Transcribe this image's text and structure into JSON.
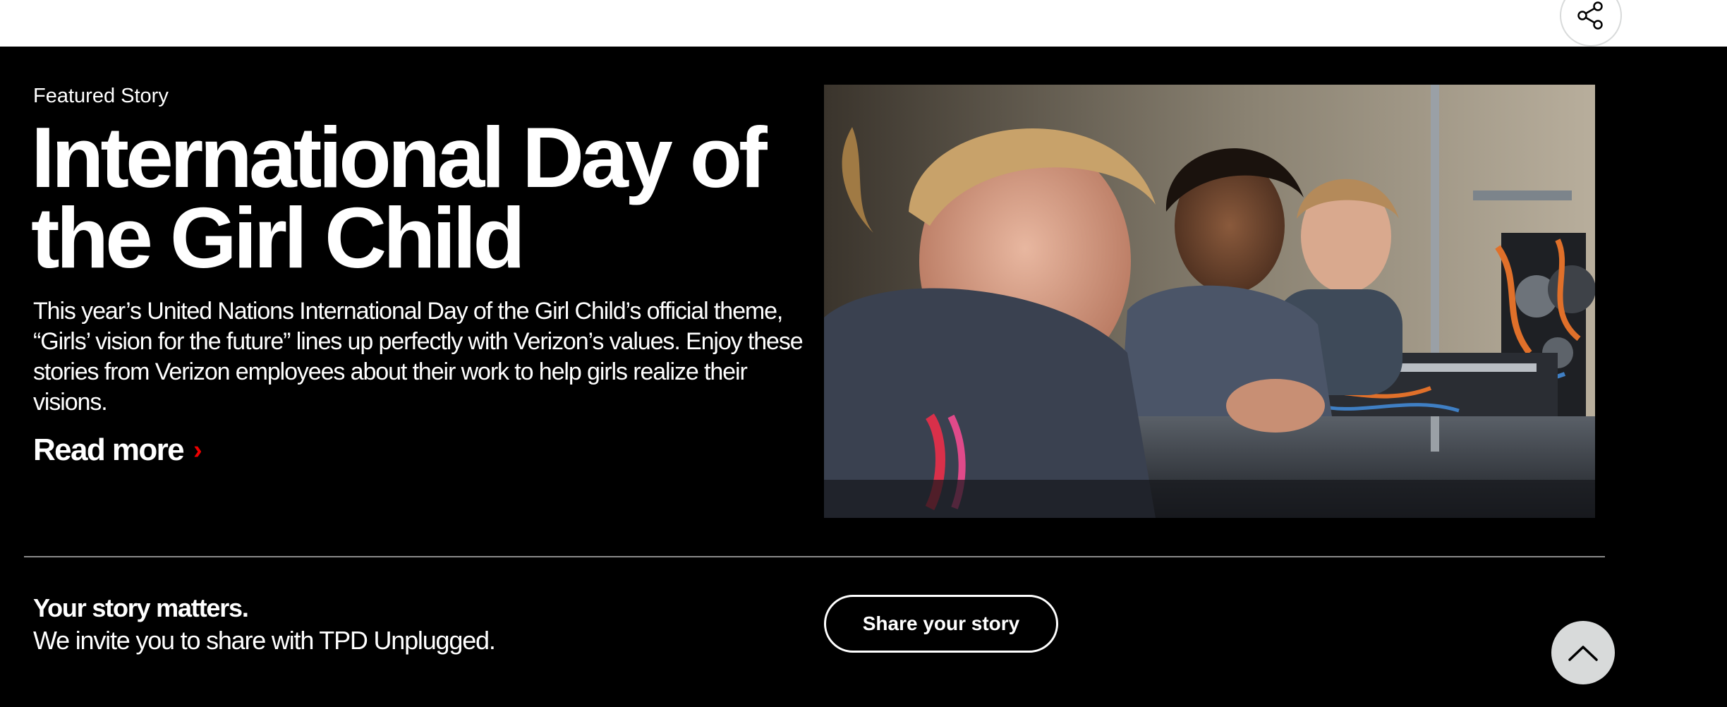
{
  "feature": {
    "eyebrow": "Featured Story",
    "title": "International Day of the Girl Child",
    "body": "This year’s United Nations International Day of the Girl Child’s official theme, “Girls’ vision for the future” lines up perfectly with Verizon’s values. Enjoy these stories from Verizon employees about their work to help girls realize their visions.",
    "read_more": "Read more",
    "read_more_chevron": "›",
    "image_alt": "Girls working on robotics equipment"
  },
  "story_cta": {
    "title": "Your story matters.",
    "subtitle": "We invite you to share with TPD Unplugged.",
    "button_label": "Share your story"
  },
  "icons": {
    "share": "share-icon",
    "scroll_top": "chevron-up-icon"
  },
  "colors": {
    "background": "#000000",
    "accent": "#ee0000",
    "text": "#ffffff",
    "button_grey": "#d8dada"
  }
}
